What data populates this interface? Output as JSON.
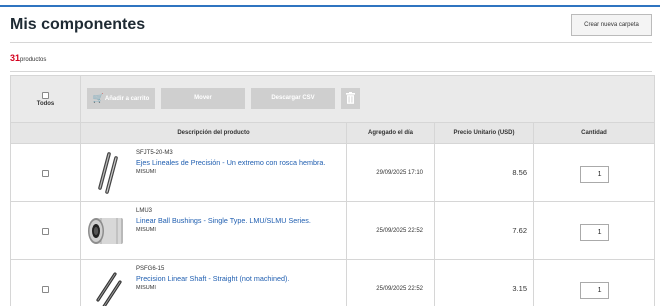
{
  "header": {
    "title": "Mis componentes",
    "new_folder_label": "Crear nueva carpeta"
  },
  "summary": {
    "count": "31",
    "count_label": "productos"
  },
  "toolbar": {
    "select_all_label": "Todos",
    "add_to_cart_label": "Añadir a carrito",
    "move_label": "Mover",
    "download_csv_label": "Descargar CSV"
  },
  "columns": {
    "description": "Descripción del producto",
    "added": "Agregado el día",
    "unit_price": "Precio Unitario (USD)",
    "quantity": "Cantidad"
  },
  "products": [
    {
      "code": "SFJT5-20-M3",
      "name": "Ejes Lineales de Precisión - Un extremo con rosca hembra.",
      "brand": "MISUMI",
      "added": "29/09/2025 17:10",
      "price": "8.56",
      "quantity": "1"
    },
    {
      "code": "LMU3",
      "name": "Linear Ball Bushings - Single Type. LMU/SLMU Series.",
      "brand": "MISUMI",
      "added": "25/09/2025 22:52",
      "price": "7.62",
      "quantity": "1"
    },
    {
      "code": "PSFG6-15",
      "name": "Precision Linear Shaft - Straight (not machined).",
      "brand": "MISUMI",
      "added": "25/09/2025 22:52",
      "price": "3.15",
      "quantity": "1"
    }
  ]
}
